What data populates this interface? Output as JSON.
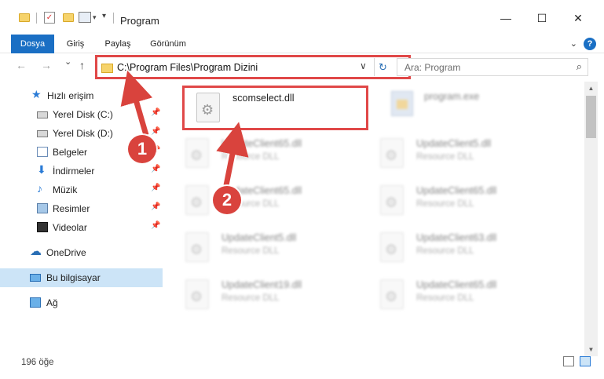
{
  "window": {
    "title": "Program",
    "minimize": "—",
    "maximize": "☐",
    "close": "✕"
  },
  "ribbon": {
    "tabs": [
      "Dosya",
      "Giriş",
      "Paylaş",
      "Görünüm"
    ],
    "help": "?"
  },
  "nav": {
    "back": "←",
    "forward": "→",
    "recent": "⌄",
    "up": "↑",
    "address_path": "C:\\Program Files\\Program Dizini",
    "address_dropdown": "∨",
    "refresh": "↻",
    "search_placeholder": "Ara: Program",
    "search_icon": "⌕"
  },
  "sidebar": {
    "items": [
      {
        "label": "Hızlı erişim",
        "icon": "star-icon",
        "pinned": false
      },
      {
        "label": "Yerel Disk (C:)",
        "icon": "drive-icon",
        "pinned": true
      },
      {
        "label": "Yerel Disk (D:)",
        "icon": "drive-icon",
        "pinned": true
      },
      {
        "label": "Belgeler",
        "icon": "documents-icon",
        "pinned": true
      },
      {
        "label": "İndirmeler",
        "icon": "download-icon",
        "pinned": true
      },
      {
        "label": "Müzik",
        "icon": "music-icon",
        "pinned": true
      },
      {
        "label": "Resimler",
        "icon": "pictures-icon",
        "pinned": true
      },
      {
        "label": "Videolar",
        "icon": "videos-icon",
        "pinned": true
      },
      {
        "label": "OneDrive",
        "icon": "onedrive-icon",
        "pinned": false
      },
      {
        "label": "Bu bilgisayar",
        "icon": "computer-icon",
        "pinned": false
      },
      {
        "label": "Ağ",
        "icon": "network-icon",
        "pinned": false
      }
    ],
    "pin_glyph": "📌"
  },
  "files": [
    {
      "name": "scomselect.dll",
      "type": ""
    },
    {
      "name": "program.exe",
      "type": ""
    },
    {
      "name": "UpdateClient65.dll",
      "type": "Resource DLL"
    },
    {
      "name": "UpdateClient5.dll",
      "type": "Resource DLL"
    },
    {
      "name": "UpdateClient65.dll",
      "type": "Resource DLL"
    },
    {
      "name": "UpdateClient65.dll",
      "type": "Resource DLL"
    },
    {
      "name": "UpdateClient5.dll",
      "type": "Resource DLL"
    },
    {
      "name": "UpdateClient63.dll",
      "type": "Resource DLL"
    },
    {
      "name": "UpdateClient19.dll",
      "type": "Resource DLL"
    },
    {
      "name": "UpdateClient65.dll",
      "type": "Resource DLL"
    }
  ],
  "callouts": [
    "1",
    "2"
  ],
  "status": {
    "item_count": "196 öğe"
  },
  "colors": {
    "accent": "#1a6fc4",
    "highlight_red": "#e04848",
    "callout_red": "#d9433d",
    "selection": "#cce4f7"
  }
}
